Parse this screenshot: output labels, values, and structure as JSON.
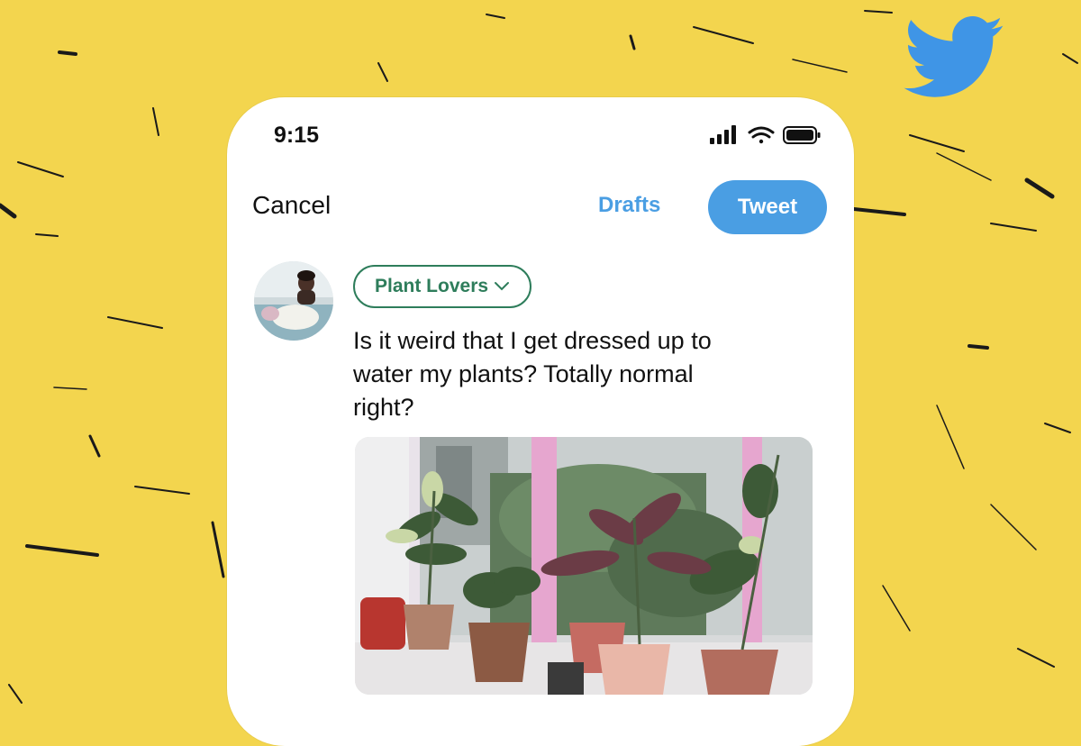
{
  "status_bar": {
    "time": "9:15"
  },
  "compose": {
    "cancel_label": "Cancel",
    "drafts_label": "Drafts",
    "tweet_label": "Tweet",
    "audience_label": "Plant Lovers",
    "tweet_text": "Is it weird that I get dressed up to\nwater my plants? Totally normal\nright?"
  },
  "icons": {
    "brand": "twitter-bird-icon",
    "status": [
      "cellular-signal-icon",
      "wifi-icon",
      "battery-icon"
    ],
    "audience": "chevron-down-icon"
  },
  "colors": {
    "background": "#f3d54e",
    "accent_blue": "#4a9ee3",
    "audience_green": "#2e7d5b",
    "text": "#111111"
  }
}
